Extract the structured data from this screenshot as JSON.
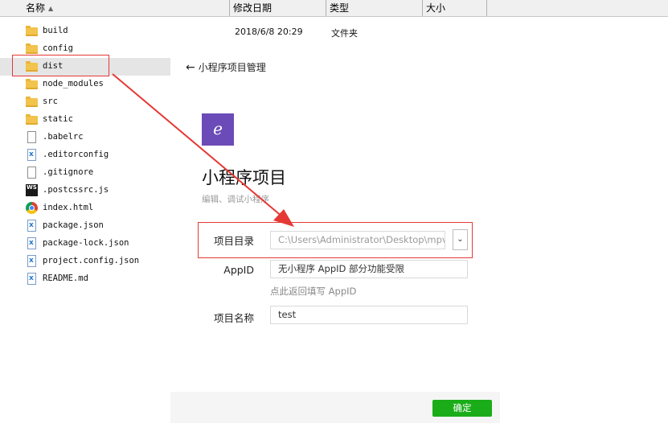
{
  "explorer": {
    "columns": [
      "名称",
      "修改日期",
      "类型",
      "大小"
    ],
    "files": [
      {
        "name": "build",
        "icon": "folder-icon"
      },
      {
        "name": "config",
        "icon": "folder-icon"
      },
      {
        "name": "dist",
        "icon": "folder-icon",
        "selected": true
      },
      {
        "name": "node_modules",
        "icon": "folder-icon"
      },
      {
        "name": "src",
        "icon": "folder-icon"
      },
      {
        "name": "static",
        "icon": "folder-icon"
      },
      {
        "name": ".babelrc",
        "icon": "file-icon"
      },
      {
        "name": ".editorconfig",
        "icon": "vscode-file-icon"
      },
      {
        "name": ".gitignore",
        "icon": "file-icon"
      },
      {
        "name": ".postcssrc.js",
        "icon": "webstorm-file-icon"
      },
      {
        "name": "index.html",
        "icon": "chrome-file-icon"
      },
      {
        "name": "package.json",
        "icon": "vscode-file-icon"
      },
      {
        "name": "package-lock.json",
        "icon": "vscode-file-icon"
      },
      {
        "name": "project.config.json",
        "icon": "vscode-file-icon"
      },
      {
        "name": "README.md",
        "icon": "vscode-file-icon"
      }
    ],
    "first_row": {
      "date": "2018/6/8 20:29",
      "type": "文件夹"
    }
  },
  "panel": {
    "back_label": "小程序项目管理",
    "logo_glyph": "ℯ",
    "title": "小程序项目",
    "subtitle": "编辑、调试小程序",
    "fields": {
      "dir_label": "项目目录",
      "dir_value": "C:\\Users\\Administrator\\Desktop\\mpvue",
      "appid_label": "AppID",
      "appid_placeholder": "无小程序 AppID 部分功能受限",
      "appid_hint": "点此返回填写 AppID",
      "name_label": "项目名称",
      "name_value": "test"
    },
    "confirm_label": "确定"
  },
  "colors": {
    "accent_green": "#1aad19",
    "logo_purple": "#6b4bb7",
    "annotation_red": "#e53935"
  }
}
